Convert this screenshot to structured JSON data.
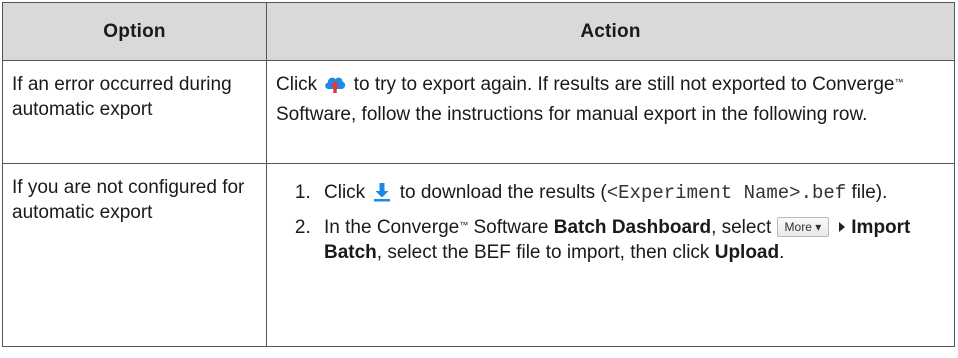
{
  "table": {
    "headers": [
      "Option",
      "Action"
    ],
    "rows": [
      {
        "option": "If an error occurred during automatic export",
        "action": {
          "click": "Click",
          "icon": "cloud-upload-icon",
          "text1": "to try to export again. If results are still not exported to Converge",
          "tm": "™",
          "text2": " Software, follow the instructions for manual export in the following row."
        }
      },
      {
        "option": "If you are not configured for automatic export",
        "steps": [
          {
            "click": "Click",
            "icon": "download-icon",
            "text1": "to download the results (",
            "mono": "<Experiment Name>.bef",
            "text2": " file)."
          },
          {
            "text1": "In the Converge",
            "tm": "™",
            "text2": " Software ",
            "bold1": "Batch Dashboard",
            "text3": ", select",
            "button": "More",
            "bold2": "Import Batch",
            "text4": ", select the BEF file to import, then click ",
            "bold3": "Upload",
            "text5": "."
          }
        ]
      }
    ]
  },
  "colors": {
    "header_bg": "#d9d9d9",
    "border": "#555555",
    "icon_blue": "#1e88e5"
  }
}
